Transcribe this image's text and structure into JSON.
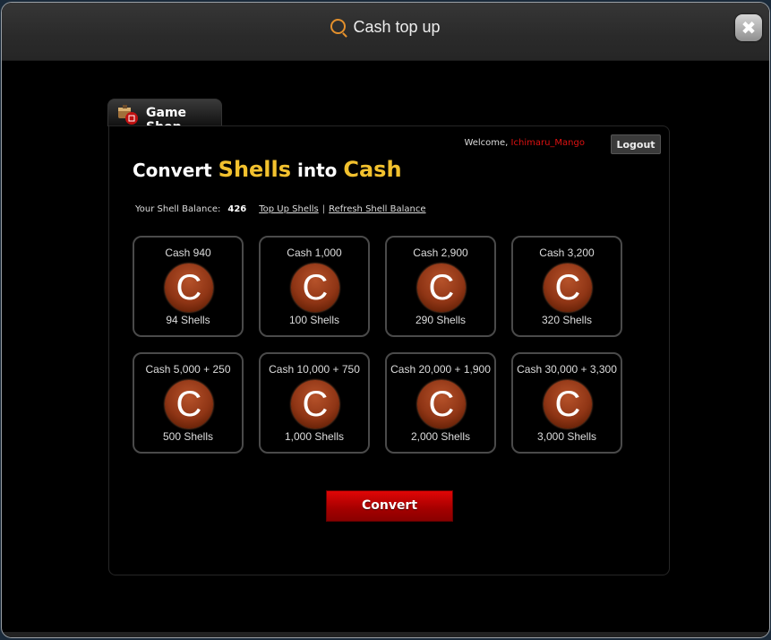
{
  "window": {
    "title": "Cash top up",
    "close_label": "✖"
  },
  "tab": {
    "label": "Game Shop"
  },
  "header": {
    "welcome_prefix": "Welcome, ",
    "username": "Ichimaru_Mango",
    "logout_label": "Logout"
  },
  "headline": {
    "part1": "Convert ",
    "part2": "Shells",
    "part3": " into ",
    "part4": "Cash"
  },
  "balance": {
    "label": "Your Shell Balance:",
    "value": "426",
    "top_up_link": "Top Up Shells",
    "separator": "|",
    "refresh_link": "Refresh Shell Balance"
  },
  "packages": [
    {
      "cash": "Cash 940",
      "coin": "C",
      "shells": "94 Shells"
    },
    {
      "cash": "Cash 1,000",
      "coin": "C",
      "shells": "100 Shells"
    },
    {
      "cash": "Cash 2,900",
      "coin": "C",
      "shells": "290 Shells"
    },
    {
      "cash": "Cash 3,200",
      "coin": "C",
      "shells": "320 Shells"
    },
    {
      "cash": "Cash 5,000 + 250",
      "coin": "C",
      "shells": "500 Shells"
    },
    {
      "cash": "Cash 10,000 + 750",
      "coin": "C",
      "shells": "1,000 Shells"
    },
    {
      "cash": "Cash 20,000 + 1,900",
      "coin": "C",
      "shells": "2,000 Shells"
    },
    {
      "cash": "Cash 30,000 + 3,300",
      "coin": "C",
      "shells": "3,000 Shells"
    }
  ],
  "convert_label": "Convert",
  "colors": {
    "accent_yellow": "#f2c12e",
    "username_red": "#dd1111",
    "button_red": "#d00000",
    "title_icon_orange": "#e4902c"
  }
}
